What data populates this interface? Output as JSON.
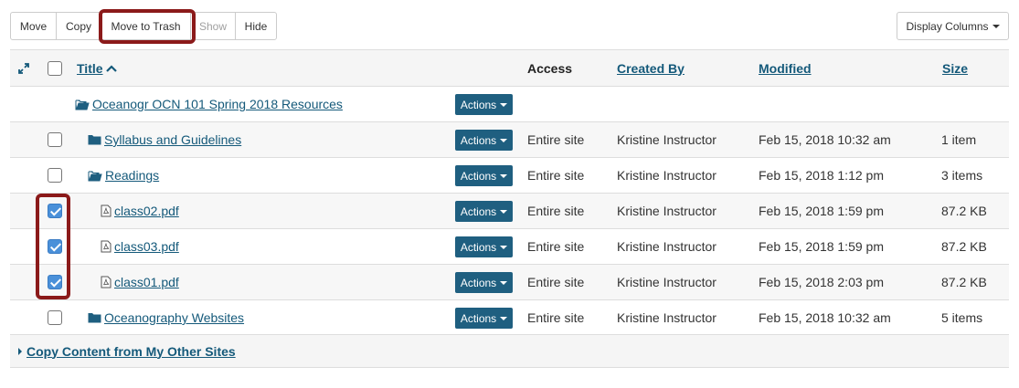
{
  "toolbar": {
    "move_label": "Move",
    "copy_label": "Copy",
    "trash_label": "Move to Trash",
    "show_label": "Show",
    "hide_label": "Hide",
    "display_columns_label": "Display Columns"
  },
  "table": {
    "headers": {
      "title": "Title",
      "access": "Access",
      "created_by": "Created By",
      "modified": "Modified",
      "size": "Size"
    },
    "actions_label": "Actions",
    "rows": [
      {
        "title": "Oceanogr OCN 101 Spring 2018 Resources",
        "icon": "folder-open-icon",
        "access": "",
        "created_by": "",
        "modified": "",
        "size": "",
        "checked": false
      },
      {
        "title": "Syllabus and Guidelines",
        "icon": "folder-icon",
        "access": "Entire site",
        "created_by": "Kristine Instructor",
        "modified": "Feb 15, 2018 10:32 am",
        "size": "1 item",
        "checked": false
      },
      {
        "title": "Readings",
        "icon": "folder-open-icon",
        "access": "Entire site",
        "created_by": "Kristine Instructor",
        "modified": "Feb 15, 2018 1:12 pm",
        "size": "3 items",
        "checked": false
      },
      {
        "title": "class02.pdf",
        "icon": "pdf-file-icon",
        "access": "Entire site",
        "created_by": "Kristine Instructor",
        "modified": "Feb 15, 2018 1:59 pm",
        "size": "87.2 KB",
        "checked": true
      },
      {
        "title": "class03.pdf",
        "icon": "pdf-file-icon",
        "access": "Entire site",
        "created_by": "Kristine Instructor",
        "modified": "Feb 15, 2018 1:59 pm",
        "size": "87.2 KB",
        "checked": true
      },
      {
        "title": "class01.pdf",
        "icon": "pdf-file-icon",
        "access": "Entire site",
        "created_by": "Kristine Instructor",
        "modified": "Feb 15, 2018 2:03 pm",
        "size": "87.2 KB",
        "checked": true
      },
      {
        "title": "Oceanography Websites",
        "icon": "folder-icon",
        "access": "Entire site",
        "created_by": "Kristine Instructor",
        "modified": "Feb 15, 2018 10:32 am",
        "size": "5 items",
        "checked": false
      }
    ]
  },
  "footer": {
    "copy_content_label": "Copy Content from My Other Sites"
  },
  "colors": {
    "link": "#14597a",
    "actions_bg": "#1f5f80",
    "highlight": "#8b1a1a",
    "checkbox_checked": "#4a90d9"
  }
}
